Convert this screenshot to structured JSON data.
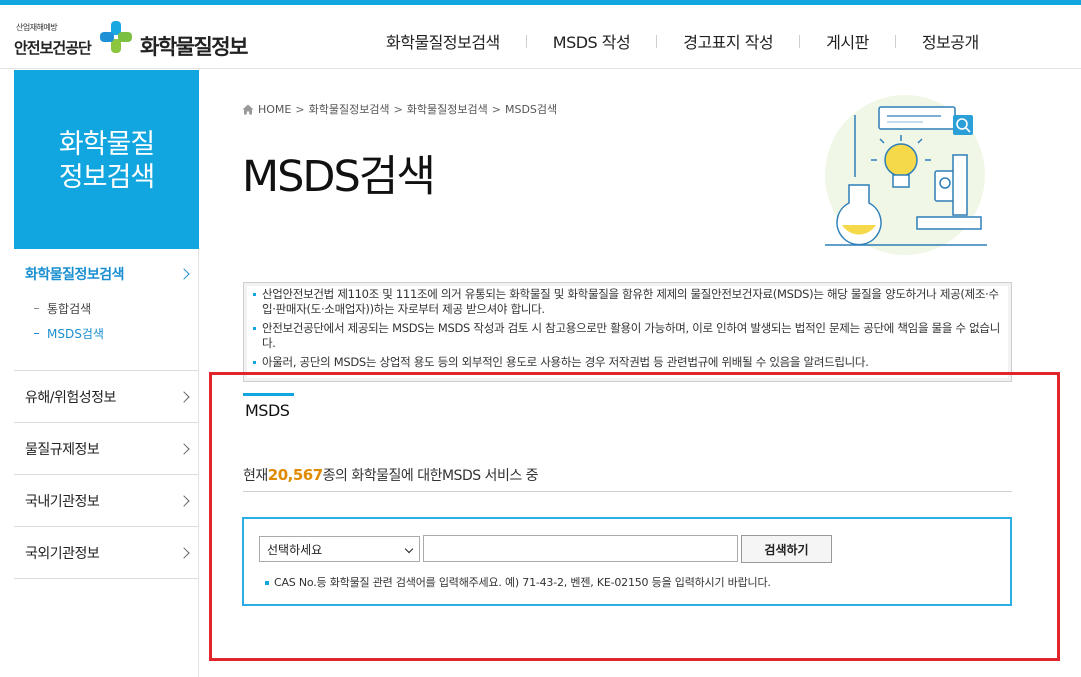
{
  "header": {
    "org_small": "산업재해예방",
    "org_name": "안전보건공단",
    "site_name": "화학물질정보",
    "nav": [
      "화학물질정보검색",
      "MSDS 작성",
      "경고표지 작성",
      "게시판",
      "정보공개"
    ]
  },
  "sidebar": {
    "title": "화학물질\n정보검색",
    "sections": [
      {
        "label": "화학물질정보검색",
        "active": true,
        "items": [
          {
            "label": "통합검색",
            "active": false
          },
          {
            "label": "MSDS검색",
            "active": true
          }
        ]
      },
      {
        "label": "유해/위험성정보",
        "active": false
      },
      {
        "label": "물질규제정보",
        "active": false
      },
      {
        "label": "국내기관정보",
        "active": false
      },
      {
        "label": "국외기관정보",
        "active": false
      }
    ]
  },
  "breadcrumb": [
    "HOME",
    "화학물질정보검색",
    "화학물질정보검색",
    "MSDS검색"
  ],
  "page_title": "MSDS검색",
  "notice": [
    "산업안전보건법 제110조 및 111조에 의거 유통되는 화학물질 및 화학물질을 함유한 제제의 물질안전보건자료(MSDS)는 해당 물질을 양도하거나 제공(제조·수입·판매자(도·소매업자))하는 자로부터 제공 받으셔야 합니다.",
    "안전보건공단에서 제공되는 MSDS는 MSDS 작성과 검토 시 참고용으로만 활용이 가능하며, 이로 인하여 발생되는 법적인 문제는 공단에 책임을 물을 수 없습니다.",
    "아울러, 공단의 MSDS는 상업적 용도 등의 외부적인 용도로 사용하는 경우 저작권법 등 관련법규에 위배될 수 있음을 알려드립니다."
  ],
  "tab_label": "MSDS",
  "count": {
    "prefix": "현재",
    "value": "20,567",
    "suffix": "종의 화학물질에 대한MSDS 서비스 중"
  },
  "search": {
    "select_value": "선택하세요",
    "input_value": "",
    "button_label": "검색하기",
    "help": "CAS No.등 화학물질 관련 검색어를 입력해주세요. 예) 71-43-2, 벤젠, KE-02150 등을 입력하시기 바랍니다."
  },
  "colors": {
    "accent": "#11a6e0",
    "highlight": "#e0262c",
    "count": "#e08a00"
  }
}
